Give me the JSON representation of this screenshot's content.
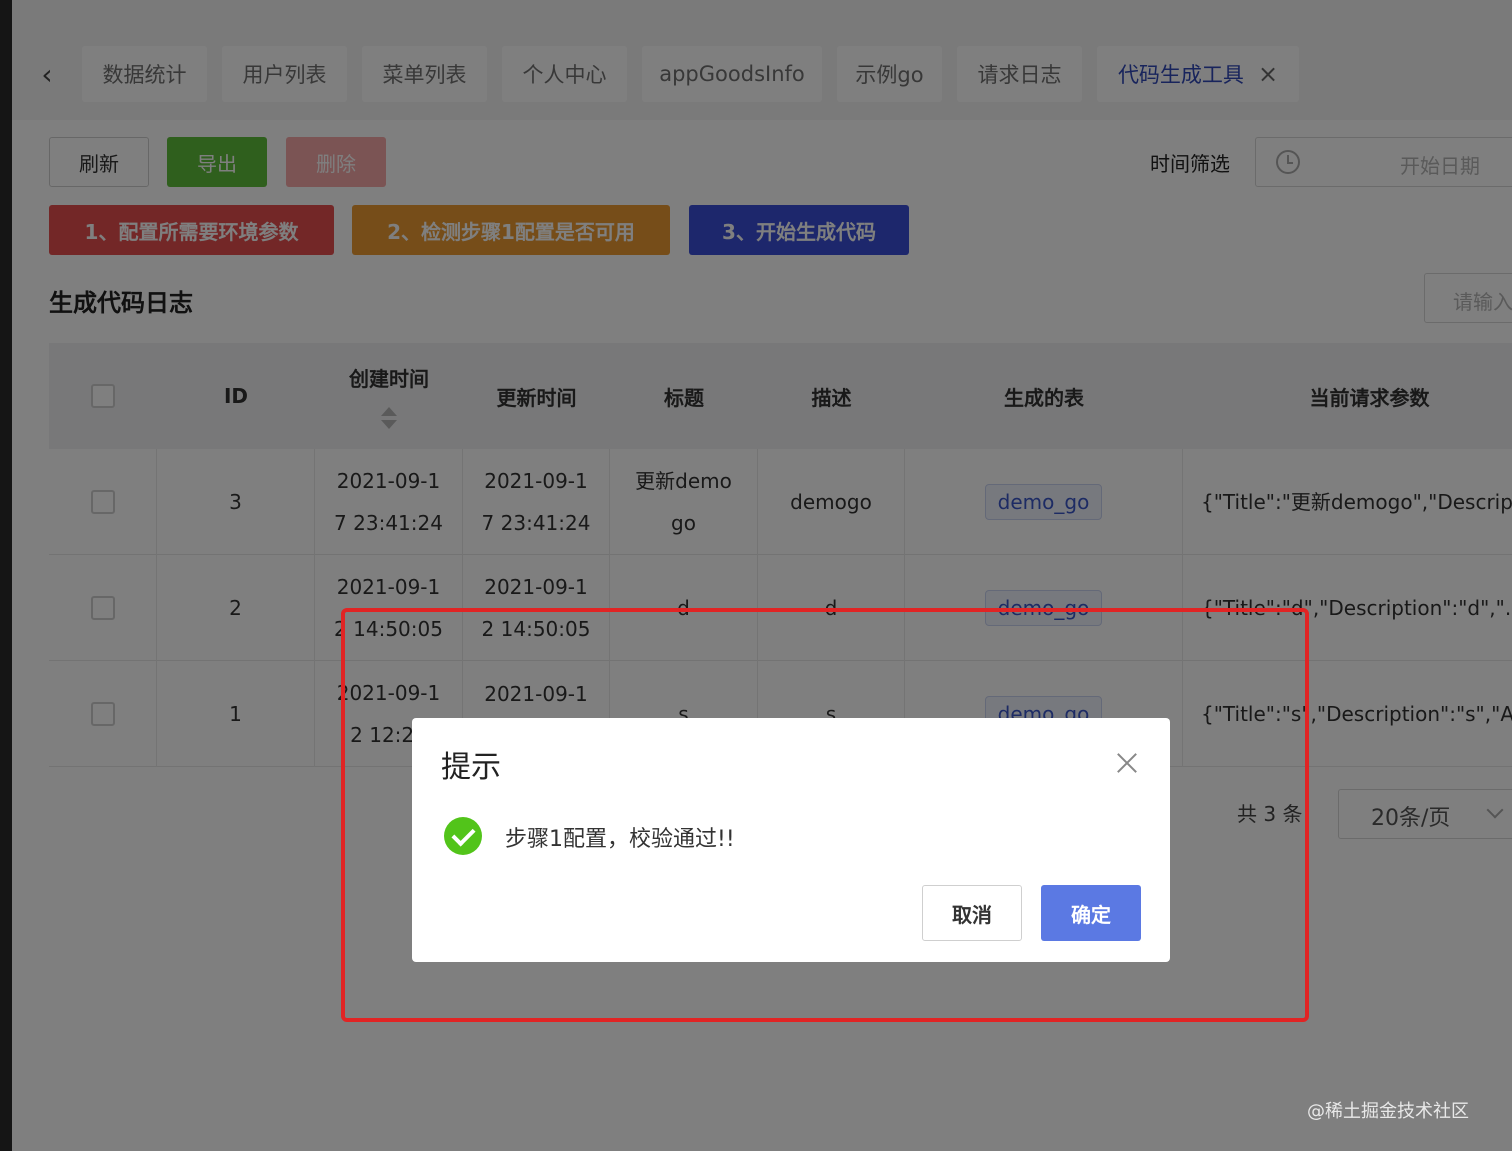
{
  "tabs": [
    {
      "label": "数据统计",
      "active": false
    },
    {
      "label": "用户列表",
      "active": false
    },
    {
      "label": "菜单列表",
      "active": false
    },
    {
      "label": "个人中心",
      "active": false
    },
    {
      "label": "appGoodsInfo",
      "active": false
    },
    {
      "label": "示例go",
      "active": false
    },
    {
      "label": "请求日志",
      "active": false
    },
    {
      "label": "代码生成工具",
      "active": true
    }
  ],
  "toolbar": {
    "refresh": "刷新",
    "export": "导出",
    "delete": "删除",
    "step1": "1、配置所需要环境参数",
    "step2": "2、检测步骤1配置是否可用",
    "step3": "3、开始生成代码",
    "time_filter_label": "时间筛选",
    "date_placeholder": "开始日期",
    "search_placeholder": "请输入"
  },
  "section_title": "生成代码日志",
  "table": {
    "headers": [
      "ID",
      "创建时间",
      "更新时间",
      "标题",
      "描述",
      "生成的表",
      "当前请求参数"
    ],
    "rows": [
      {
        "id": "3",
        "created_l1": "2021-09-1",
        "created_l2": "7 23:41:24",
        "updated_l1": "2021-09-1",
        "updated_l2": "7 23:41:24",
        "title_l1": "更新demo",
        "title_l2": "go",
        "desc": "demogo",
        "table": "demo_go",
        "params": "{\"Title\":\"更新demogo\",\"Descrip"
      },
      {
        "id": "2",
        "created_l1": "2021-09-1",
        "created_l2": "2 14:50:05",
        "updated_l1": "2021-09-1",
        "updated_l2": "2 14:50:05",
        "title_l1": "d",
        "title_l2": "",
        "desc": "d",
        "table": "demo_go",
        "params": "{\"Title\":\"d\",\"Description\":\"d\",\"..."
      },
      {
        "id": "1",
        "created_l1": "2021-09-1",
        "created_l2": "2 12:29",
        "updated_l1": "2021-09-1",
        "updated_l2": "",
        "title_l1": "s",
        "title_l2": "",
        "desc": "s",
        "table": "demo_go",
        "params": "{\"Title\":\"s\",\"Description\":\"s\",\"A"
      }
    ]
  },
  "pager": {
    "total": "共 3 条",
    "page_size": "20条/页"
  },
  "watermark": "@稀土掘金技术社区",
  "dialog": {
    "title": "提示",
    "message": "步骤1配置，校验通过!!",
    "cancel": "取消",
    "confirm": "确定"
  },
  "colors": {
    "accent": "#3049b8",
    "export": "#5fbf3a",
    "danger": "#e64f4f",
    "warning": "#ec9b32",
    "primary": "#3b4fd8",
    "confirm": "#5b79e3",
    "success": "#52c41a",
    "annotation": "#e12424"
  }
}
